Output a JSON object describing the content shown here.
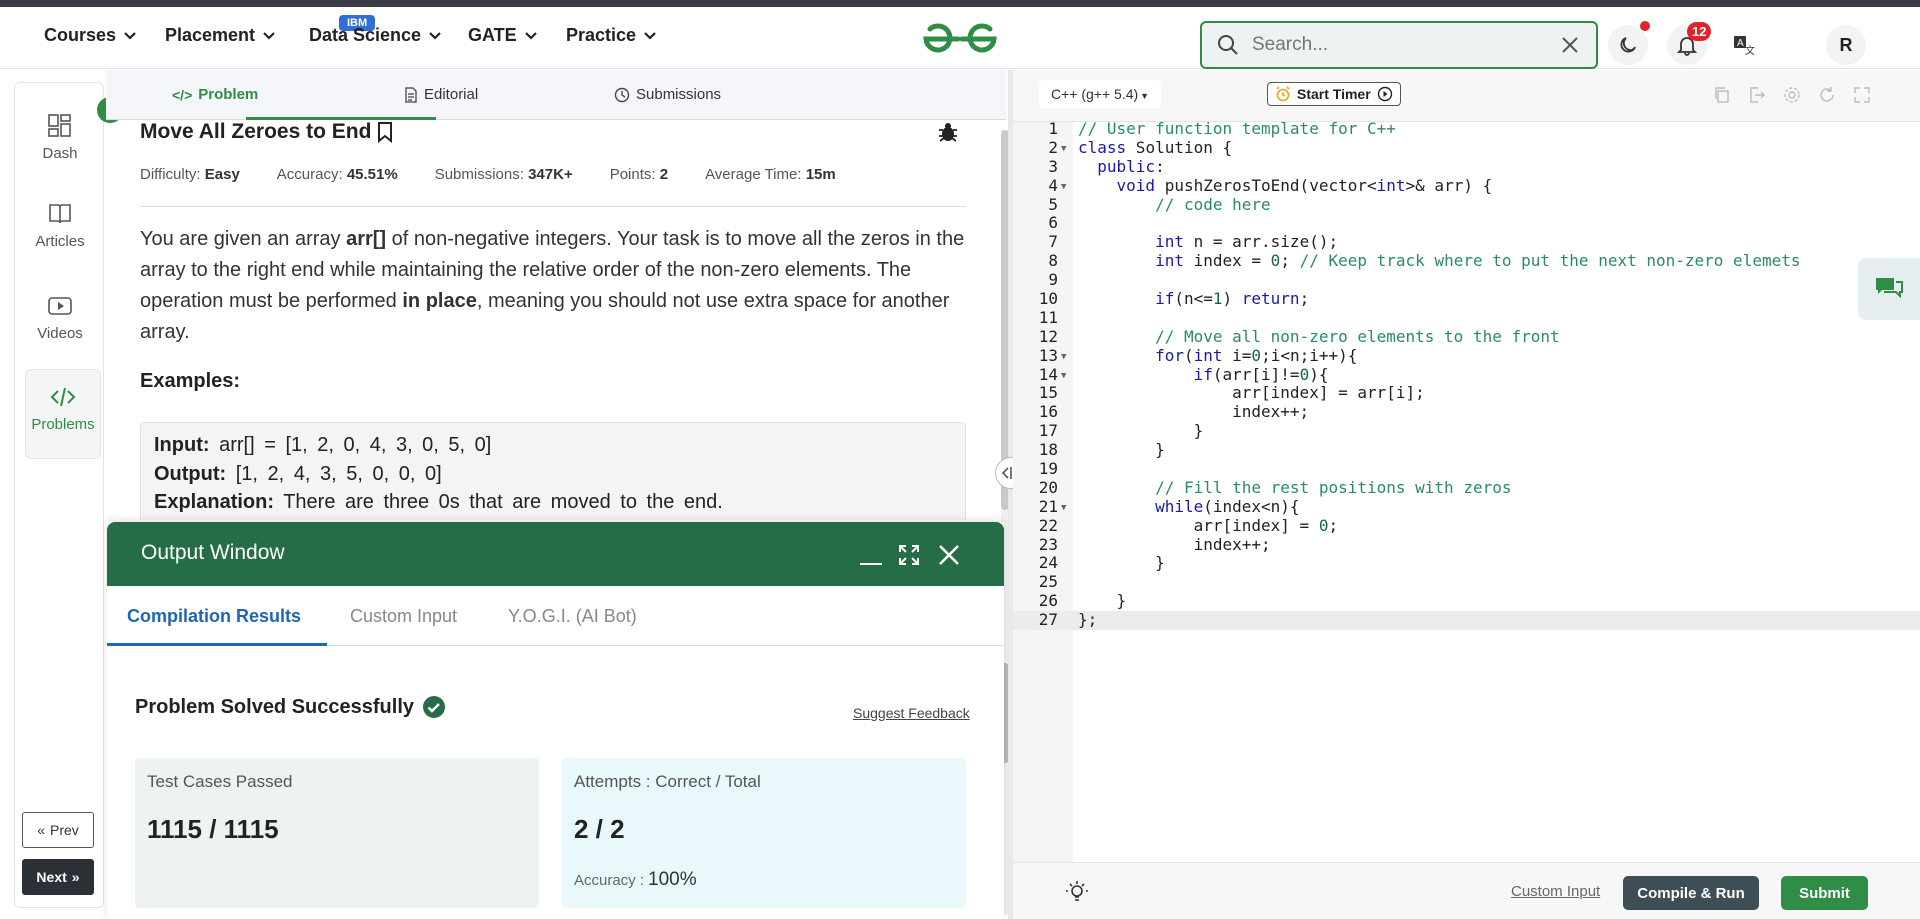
{
  "nav": {
    "items": [
      {
        "label": "Courses"
      },
      {
        "label": "Placement"
      },
      {
        "label": "Data Science"
      },
      {
        "label": "GATE"
      },
      {
        "label": "Practice"
      }
    ],
    "ibm_badge": "IBM",
    "search_placeholder": "Search...",
    "notification_count": "12",
    "avatar_letter": "R"
  },
  "sidebar": {
    "items": [
      {
        "label": "Dash",
        "icon": "dashboard-icon"
      },
      {
        "label": "Articles",
        "icon": "book-icon"
      },
      {
        "label": "Videos",
        "icon": "video-icon"
      },
      {
        "label": "Problems",
        "icon": "code-icon"
      }
    ],
    "prev_label": "Prev",
    "next_label": "Next"
  },
  "problem_tabs": [
    {
      "label": "Problem"
    },
    {
      "label": "Editorial"
    },
    {
      "label": "Submissions"
    }
  ],
  "problem": {
    "title": "Move All Zeroes to End",
    "meta": {
      "difficulty_label": "Difficulty:",
      "difficulty": "Easy",
      "accuracy_label": "Accuracy:",
      "accuracy": "45.51%",
      "submissions_label": "Submissions:",
      "submissions": "347K+",
      "points_label": "Points:",
      "points": "2",
      "time_label": "Average Time:",
      "time": "15m"
    },
    "desc_part1": "You are given an array ",
    "desc_bold1": "arr[]",
    "desc_part2": " of non-negative integers. Your task is to move all the zeros in the array to the right end while maintaining the relative order of the non-zero elements. The operation must be performed ",
    "desc_bold2": "in place",
    "desc_part3": ", meaning you should not use extra space for another array.",
    "examples_heading": "Examples:",
    "example": {
      "input_label": "Input:",
      "input": "arr[] = [1, 2, 0, 4, 3, 0, 5, 0]",
      "output_label": "Output:",
      "output": "[1, 2, 4, 3, 5, 0, 0, 0]",
      "explanation_label": "Explanation:",
      "explanation": "There are three 0s that are moved to the end."
    }
  },
  "output_window": {
    "title": "Output Window",
    "tabs": [
      {
        "label": "Compilation Results"
      },
      {
        "label": "Custom Input"
      },
      {
        "label": "Y.O.G.I. (AI Bot)"
      }
    ],
    "status": "Problem Solved Successfully",
    "feedback_link": "Suggest Feedback",
    "tests_label": "Test Cases Passed",
    "tests_value": "1115 / 1115",
    "attempts_label": "Attempts : Correct / Total",
    "attempts_value": "2 / 2",
    "accuracy_label": "Accuracy :",
    "accuracy_value": "100%"
  },
  "editor": {
    "language": "C++ (g++ 5.4)",
    "timer_label": "Start Timer",
    "custom_input_link": "Custom Input",
    "compile_label": "Compile & Run",
    "submit_label": "Submit",
    "code_lines": [
      "// User function template for C++",
      "class Solution {",
      "  public:",
      "    void pushZerosToEnd(vector<int>& arr) {",
      "        // code here",
      "",
      "        int n = arr.size();",
      "        int index = 0; // Keep track where to put the next non-zero elemets",
      "",
      "        if(n<=1) return;",
      "",
      "        // Move all non-zero elements to the front",
      "        for(int i=0;i<n;i++){",
      "            if(arr[i]!=0){",
      "                arr[index] = arr[i];",
      "                index++;",
      "            }",
      "        }",
      "",
      "        // Fill the rest positions with zeros",
      "        while(index<n){",
      "            arr[index] = 0;",
      "            index++;",
      "        }",
      "",
      "    }",
      "};"
    ]
  },
  "colors": {
    "brand_green": "#2f8d46",
    "output_header": "#256d47",
    "tab_blue": "#1e66b5"
  }
}
